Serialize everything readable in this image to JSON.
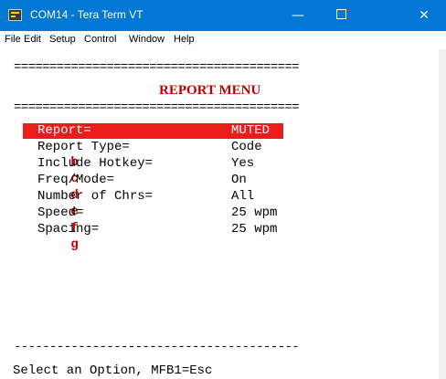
{
  "window": {
    "title": "COM14 - Tera Term VT",
    "minimize_glyph": "—",
    "close_glyph": "✕"
  },
  "menubar": [
    "File",
    "Edit",
    "Setup",
    "Control",
    "Window",
    "Help"
  ],
  "terminal": {
    "separator": "========================================",
    "title": "REPORT MENU",
    "bottom_separator": "----------------------------------------",
    "options": [
      {
        "key": "a",
        "label": "Report=",
        "value": "MUTED",
        "selected": true
      },
      {
        "key": "b",
        "label": "Report Type=",
        "value": "Code"
      },
      {
        "key": "c",
        "label": "Include Hotkey=",
        "value": "Yes"
      },
      {
        "key": "d",
        "label": "Freq/Mode=",
        "value": "On"
      },
      {
        "key": "e",
        "label": "Number of Chrs=",
        "value": "All"
      },
      {
        "key": "f",
        "label": "Speed=",
        "value": "25 wpm"
      },
      {
        "key": "g",
        "label": "Spacing=",
        "value": "25 wpm"
      }
    ],
    "status_line": "Select an Option, MFB1=Esc"
  },
  "colors": {
    "titlebar": "#0078d4",
    "key_red": "#c00000",
    "selection_red": "#ea1c1c"
  }
}
